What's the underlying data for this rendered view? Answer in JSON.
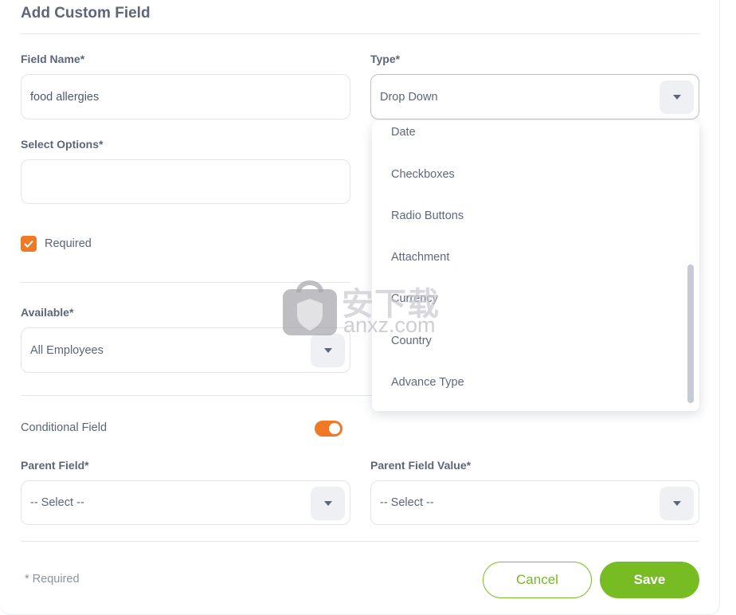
{
  "dialog": {
    "title": "Add Custom Field"
  },
  "form": {
    "field_name": {
      "label": "Field Name*",
      "value": "food allergies"
    },
    "type": {
      "label": "Type*",
      "value": "Drop Down"
    },
    "select_options": {
      "label": "Select Options*",
      "value": ""
    },
    "required": {
      "label": "Required",
      "checked": true
    },
    "available": {
      "label": "Available*",
      "value": "All Employees"
    },
    "conditional_field": {
      "label": "Conditional Field",
      "on": true
    },
    "parent_field": {
      "label": "Parent Field*",
      "value": "-- Select --"
    },
    "parent_field_value": {
      "label": "Parent Field Value*",
      "value": "-- Select --"
    }
  },
  "type_dropdown": {
    "options": [
      "Date",
      "Checkboxes",
      "Radio Buttons",
      "Attachment",
      "Currency",
      "Country",
      "Advance Type"
    ]
  },
  "footer": {
    "required_note": "* Required",
    "cancel_label": "Cancel",
    "save_label": "Save"
  },
  "watermark": {
    "text_cn": "安下载",
    "text_en": "anxz.com"
  },
  "colors": {
    "accent_orange": "#f07a24",
    "accent_green": "#76bc22",
    "label_text": "#5d6678",
    "border": "#e1e5eb"
  },
  "icons": {
    "caret": "chevron-down-icon",
    "check": "check-icon"
  }
}
